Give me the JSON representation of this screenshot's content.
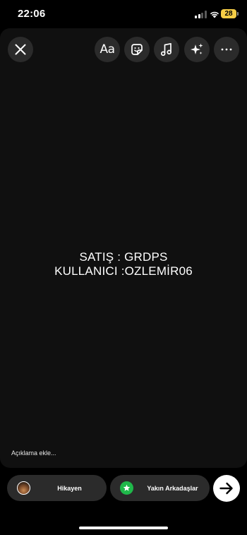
{
  "status_bar": {
    "time": "22:06",
    "battery_level": "28"
  },
  "toolbar": {
    "close_icon": "close-icon",
    "text_label": "Aa",
    "sticker_icon": "sticker-icon",
    "music_icon": "music-note-icon",
    "effects_icon": "sparkles-icon",
    "more_icon": "more-horizontal-icon"
  },
  "story": {
    "lines": [
      "SATIŞ : GRDPS",
      "KULLANICI :OZLEMİR06"
    ],
    "caption_placeholder": "Açıklama ekle..."
  },
  "share_bar": {
    "story_label": "Hikayen",
    "close_friends_label": "Yakın Arkadaşlar",
    "close_friends_color": "#1fb84a",
    "send_icon": "arrow-right-icon"
  },
  "colors": {
    "background": "#000000",
    "canvas": "#101010",
    "button_bg": "#2b2b2b",
    "battery": "#f7ce46"
  }
}
